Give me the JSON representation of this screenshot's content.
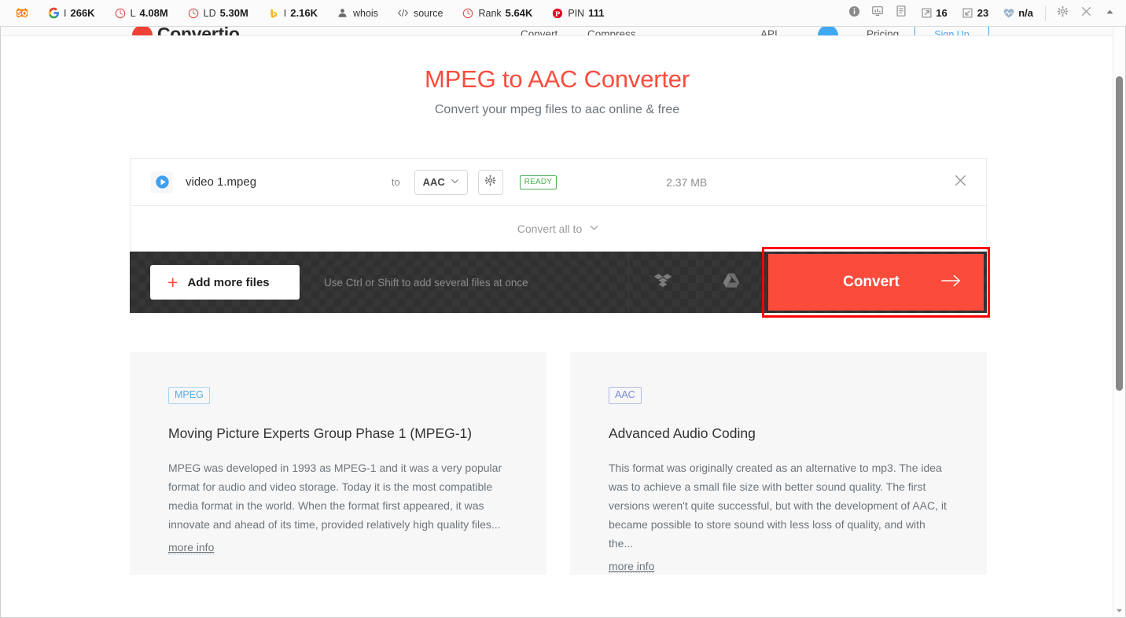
{
  "extension_toolbar": {
    "left_items": [
      {
        "icon": "seoquake-logo-icon",
        "label": "",
        "value": ""
      },
      {
        "icon": "google-icon",
        "label": "I",
        "value": "266K"
      },
      {
        "icon": "alexa-rank-icon",
        "label": "L",
        "value": "4.08M"
      },
      {
        "icon": "moz-link-domain-icon",
        "label": "LD",
        "value": "5.30M"
      },
      {
        "icon": "bing-icon",
        "label": "I",
        "value": "2.16K"
      },
      {
        "icon": "whois-person-icon",
        "label": "whois",
        "value": ""
      },
      {
        "icon": "source-code-icon",
        "label": "source",
        "value": ""
      },
      {
        "icon": "rank-circle-icon",
        "label": "Rank",
        "value": "5.64K"
      },
      {
        "icon": "pinterest-icon",
        "label": "PIN",
        "value": "111"
      }
    ],
    "right_items": [
      {
        "icon": "info-circle-icon",
        "value": ""
      },
      {
        "icon": "page-analysis-icon",
        "value": ""
      },
      {
        "icon": "page-report-icon",
        "value": ""
      },
      {
        "icon": "external-links-icon",
        "value": "16"
      },
      {
        "icon": "internal-links-icon",
        "value": "23"
      },
      {
        "icon": "health-icon",
        "value": "n/a"
      }
    ],
    "settings_icon": "gear-icon",
    "close_icon": "close-icon",
    "collapse_icon": "chevron-up-icon"
  },
  "site_header": {
    "logo_text": "Convertio",
    "nav": [
      "Convert",
      "Compress",
      "API",
      "Pricing"
    ],
    "cta_label": "Sign Up"
  },
  "hero": {
    "title": "MPEG to AAC Converter",
    "subtitle": "Convert your mpeg files to aac online & free",
    "title_color": "#fa4c3c"
  },
  "file_row": {
    "file_icon": "video-play-icon",
    "file_name": "video 1.mpeg",
    "to_label": "to",
    "format_value": "AAC",
    "format_caret_icon": "chevron-down-icon",
    "settings_icon": "gear-icon",
    "status": "READY",
    "status_color": "#4caf50",
    "file_size": "2.37 MB",
    "remove_icon": "close-icon"
  },
  "convert_all": {
    "label": "Convert all to",
    "caret_icon": "chevron-down-icon"
  },
  "action_bar": {
    "add_files_label": "Add more files",
    "add_files_icon": "plus-icon",
    "hint": "Use Ctrl or Shift to add several files at once",
    "dropbox_icon": "dropbox-icon",
    "google_drive_icon": "google-drive-icon",
    "convert_label": "Convert",
    "convert_arrow_icon": "arrow-right-icon",
    "convert_color": "#fa4b3b",
    "highlight_color": "#ff0000"
  },
  "cards": [
    {
      "tag": "MPEG",
      "tag_style": "blue",
      "title": "Moving Picture Experts Group Phase 1 (MPEG-1)",
      "description": "MPEG was developed in 1993 as MPEG-1 and it was a very popular format for audio and video storage. Today it is the most compatible media format in the world. When the format first appeared, it was innovate and ahead of its time, provided relatively high quality files...",
      "more_info": "more info"
    },
    {
      "tag": "AAC",
      "tag_style": "violet",
      "title": "Advanced Audio Coding",
      "description": "This format was originally created as an alternative to mp3. The idea was to achieve a small file size with better sound quality. The first versions weren't quite successful, but with the development of AAC, it became possible to store sound with less loss of quality, and with the...",
      "more_info": "more info"
    }
  ],
  "scrollbar": {
    "down_arrow_icon": "chevron-down-icon"
  }
}
